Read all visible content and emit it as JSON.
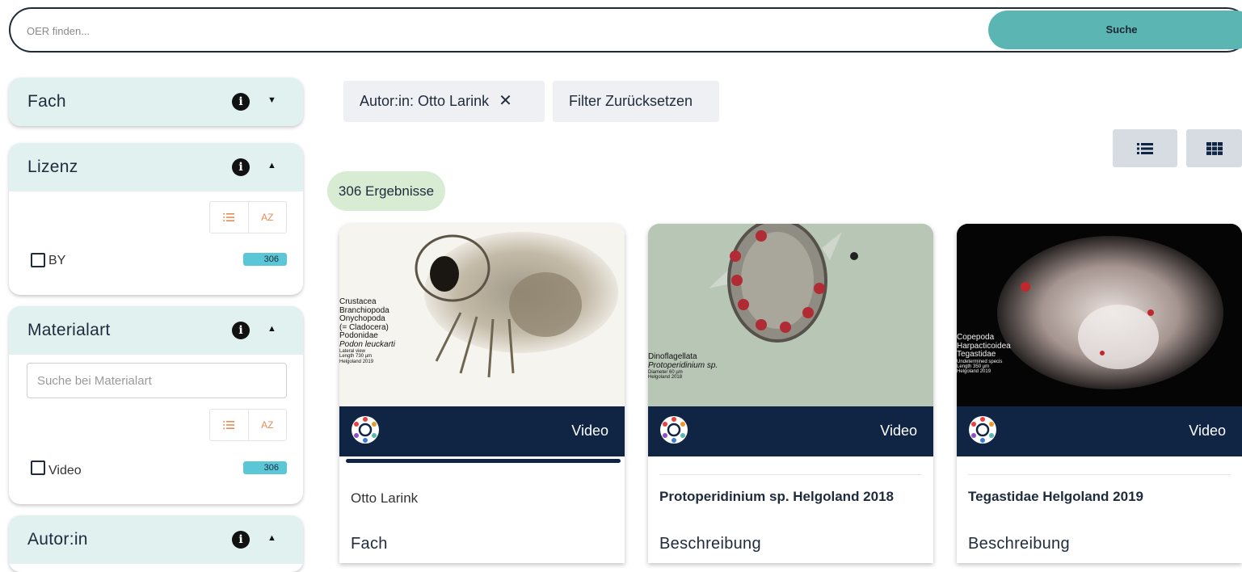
{
  "search": {
    "placeholder": "OER finden...",
    "button_label": "Suche"
  },
  "sidebar": {
    "fach": {
      "title": "Fach"
    },
    "lizenz": {
      "title": "Lizenz",
      "option_label": "BY",
      "option_count": "306",
      "sort_alpha": "AZ"
    },
    "materialart": {
      "title": "Materialart",
      "search_placeholder": "Suche bei Materialart",
      "option_label": "Video",
      "option_count": "306",
      "sort_alpha": "AZ"
    },
    "autorin": {
      "title": "Autor:in"
    }
  },
  "filters": {
    "active_chip": "Autor:in: Otto Larink",
    "reset_label": "Filter Zurücksetzen"
  },
  "results": {
    "count_label": "306 Ergebnisse"
  },
  "cards": [
    {
      "type": "Video",
      "image_caption": [
        "Crustacea",
        "Branchiopoda",
        "Onychopoda",
        "(= Cladocera)",
        "Podonidae",
        "Podon leuckarti",
        "Lateral view",
        "Length 730 µm",
        "Helgoland 2019"
      ],
      "author": "Otto Larink",
      "section": "Fach"
    },
    {
      "type": "Video",
      "image_caption": [
        "Dinoflagellata",
        "Protoperidinium sp.",
        "Diameter 60 µm",
        "Helgoland 2018"
      ],
      "title": "Protoperidinium sp. Helgoland 2018",
      "section": "Beschreibung"
    },
    {
      "type": "Video",
      "image_caption": [
        "Copepoda",
        "Harpacticoidea",
        "Tegastidae",
        "Undetermined specis",
        "Length 350 µm",
        "Helgoland 2019"
      ],
      "title": "Tegastidae Helgoland 2019",
      "section": "Beschreibung"
    }
  ],
  "colors": {
    "accent": "#5bb5b3",
    "panel_header": "#e0f1f0",
    "card_bar": "#102444",
    "badge": "#5bc7d6",
    "results_badge": "#d8ebd3"
  }
}
